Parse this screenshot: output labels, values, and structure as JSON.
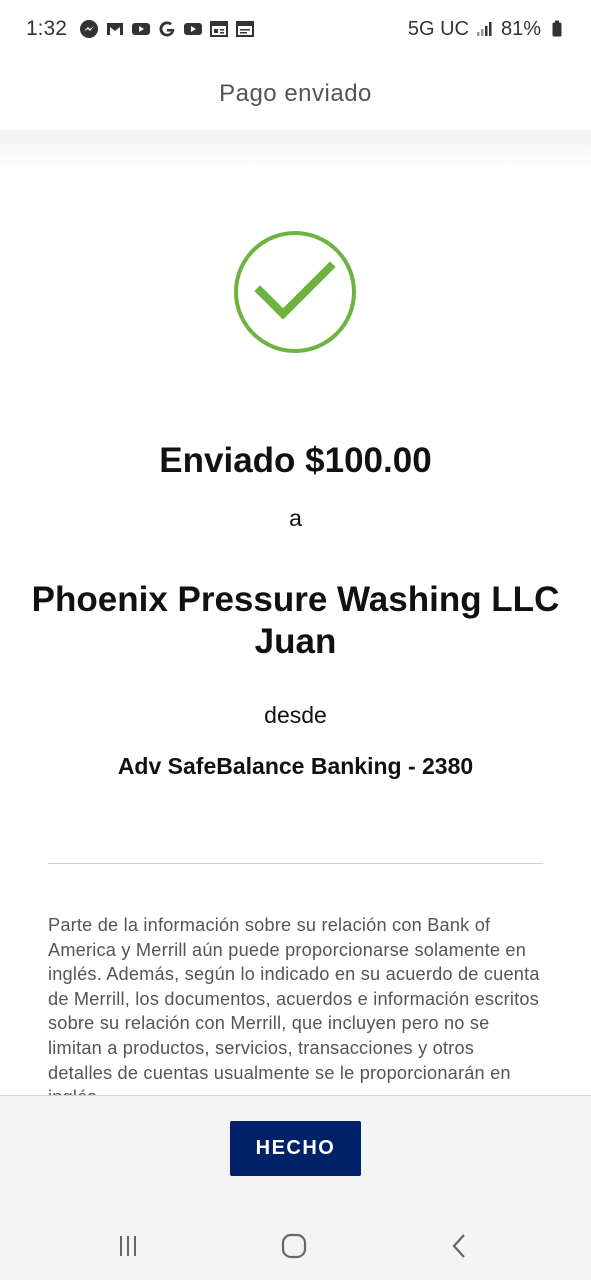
{
  "status_bar": {
    "time": "1:32",
    "notification_icons": [
      "messenger-icon",
      "gmail-icon",
      "youtube-icon",
      "google-icon",
      "youtube-icon",
      "news-icon",
      "calendar-icon"
    ],
    "network": "5G UC",
    "battery": "81%"
  },
  "header": {
    "title": "Pago enviado"
  },
  "confirmation": {
    "sent_line": "Enviado $100.00",
    "to_word": "a",
    "recipient_name": "Phoenix Pressure Washing LLC",
    "recipient_contact": "Juan",
    "from_word": "desde",
    "account": "Adv SafeBalance Banking - 2380"
  },
  "disclaimer": "Parte de la información sobre su relación con Bank of America y Merrill aún puede proporcionarse solamente en inglés. Además, según lo indicado en su acuerdo de cuenta de Merrill, los documentos, acuerdos e información escritos sobre su relación con Merrill, que incluyen pero no se limitan a productos, servicios, transacciones y otros detalles de cuentas usualmente se le proporcionarán en inglés.",
  "footer": {
    "done_label": "HECHO"
  },
  "colors": {
    "accent_navy": "#012169",
    "success_green": "#6cb33f"
  }
}
